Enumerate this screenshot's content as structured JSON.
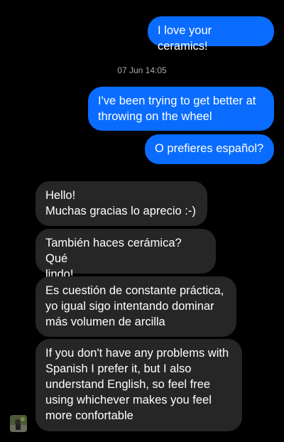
{
  "timestamp": "07 Jun 14:05",
  "messages": {
    "m1": "I love your ceramics!",
    "m2": "I've been trying to get better at\nthrowing on the wheel",
    "m3": "O prefieres español?",
    "m4": "Hello!\nMuchas gracias lo aprecio :-)",
    "m5": "También haces cerámica? Qué\nlindo!",
    "m6": "Es cuestión de constante práctica,\nyo igual sigo intentando dominar\nmás volumen de arcilla",
    "m7": "If you don't have any problems with\nSpanish I prefer it, but I also\nunderstand English, so feel free\nusing whichever makes you feel\nmore confortable"
  },
  "colors": {
    "outgoing_bubble": "#0a6cff",
    "incoming_bubble": "#262626",
    "background": "#000000"
  },
  "icons": {
    "avatar": "contact-avatar"
  }
}
